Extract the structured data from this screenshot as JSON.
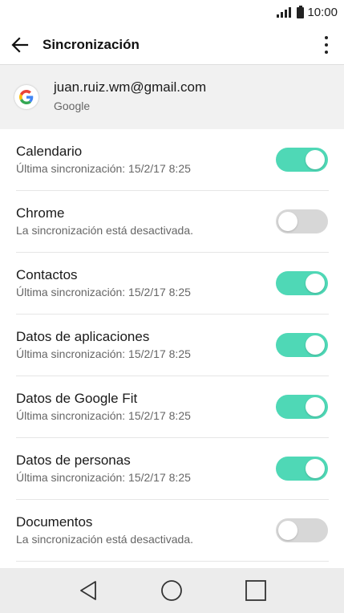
{
  "status": {
    "time": "10:00"
  },
  "appbar": {
    "title": "Sincronización"
  },
  "account": {
    "email": "juan.ruiz.wm@gmail.com",
    "provider": "Google"
  },
  "accent_color": "#4fd8b6",
  "items": [
    {
      "title": "Calendario",
      "subtitle": "Última sincronización: 15/2/17 8:25",
      "enabled": true
    },
    {
      "title": "Chrome",
      "subtitle": "La sincronización está desactivada.",
      "enabled": false
    },
    {
      "title": "Contactos",
      "subtitle": "Última sincronización: 15/2/17 8:25",
      "enabled": true
    },
    {
      "title": "Datos de aplicaciones",
      "subtitle": "Última sincronización: 15/2/17 8:25",
      "enabled": true
    },
    {
      "title": "Datos de Google Fit",
      "subtitle": "Última sincronización: 15/2/17 8:25",
      "enabled": true
    },
    {
      "title": "Datos de personas",
      "subtitle": "Última sincronización: 15/2/17 8:25",
      "enabled": true
    },
    {
      "title": "Documentos",
      "subtitle": "La sincronización está desactivada.",
      "enabled": false
    }
  ],
  "icons": {
    "back": "arrow-left-icon",
    "more": "more-vertical-icon",
    "account": "google-g-icon",
    "nav_back": "triangle-back-icon",
    "nav_home": "circle-home-icon",
    "nav_recents": "square-recents-icon"
  }
}
